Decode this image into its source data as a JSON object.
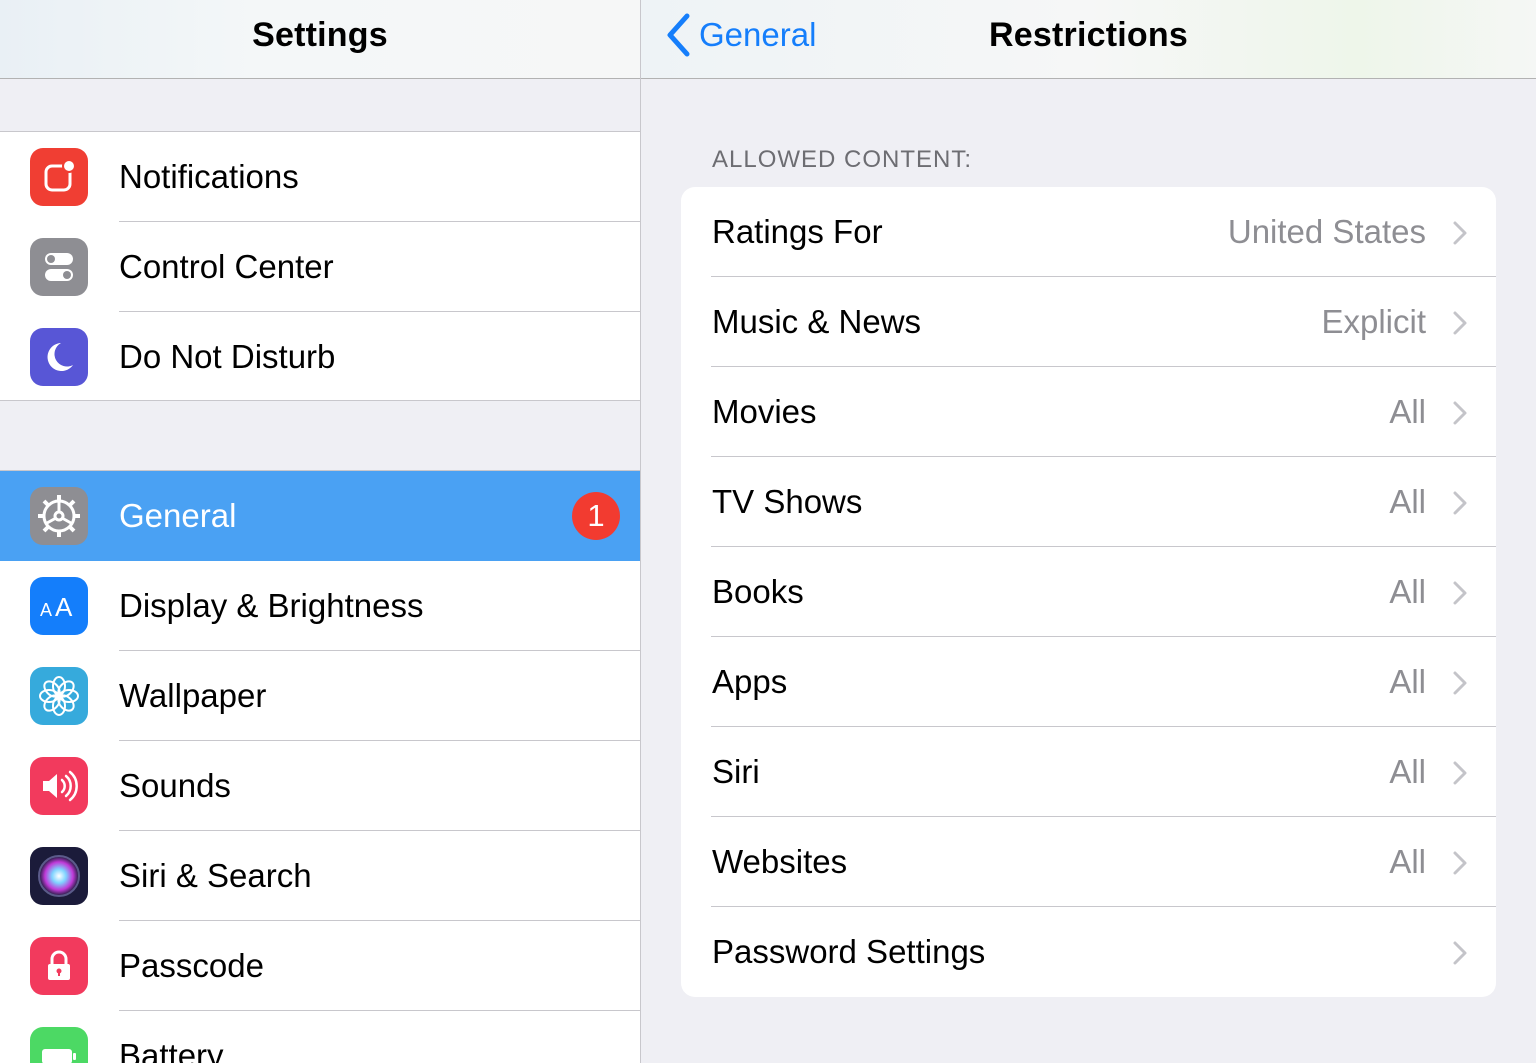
{
  "master": {
    "title": "Settings",
    "groups": [
      [
        {
          "label": "Notifications",
          "icon": "notifications-icon",
          "color": "#f03e33"
        },
        {
          "label": "Control Center",
          "icon": "control-center-icon",
          "color": "#8e8e93"
        },
        {
          "label": "Do Not Disturb",
          "icon": "moon-icon",
          "color": "#5856d6"
        }
      ],
      [
        {
          "label": "General",
          "icon": "gear-icon",
          "color": "#8e8e93",
          "selected": true,
          "badge": "1"
        },
        {
          "label": "Display & Brightness",
          "icon": "display-brightness-icon",
          "color": "#147efb"
        },
        {
          "label": "Wallpaper",
          "icon": "wallpaper-flower-icon",
          "color": "#36aadc"
        },
        {
          "label": "Sounds",
          "icon": "speaker-icon",
          "color": "#f23a5d"
        },
        {
          "label": "Siri & Search",
          "icon": "siri-icon",
          "color": "#1b1b3a"
        },
        {
          "label": "Passcode",
          "icon": "lock-icon",
          "color": "#f23a5d"
        },
        {
          "label": "Battery",
          "icon": "battery-icon",
          "color": "#4cd964"
        }
      ]
    ]
  },
  "detail": {
    "back_label": "General",
    "title": "Restrictions",
    "section_header": "ALLOWED CONTENT:",
    "rows": [
      {
        "label": "Ratings For",
        "value": "United States"
      },
      {
        "label": "Music & News",
        "value": "Explicit"
      },
      {
        "label": "Movies",
        "value": "All"
      },
      {
        "label": "TV Shows",
        "value": "All"
      },
      {
        "label": "Books",
        "value": "All"
      },
      {
        "label": "Apps",
        "value": "All"
      },
      {
        "label": "Siri",
        "value": "All"
      },
      {
        "label": "Websites",
        "value": "All"
      },
      {
        "label": "Password Settings",
        "value": ""
      }
    ]
  },
  "colors": {
    "accent": "#157efb",
    "selection": "#4aa1f3",
    "badge": "#f23b30",
    "secondary_text": "#8e8e93"
  }
}
